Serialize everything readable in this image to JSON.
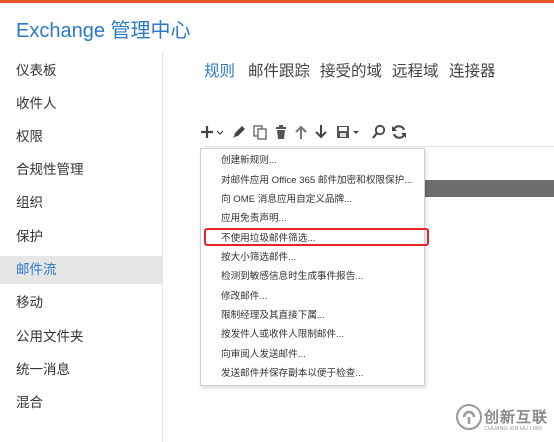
{
  "app": {
    "title": "Exchange 管理中心"
  },
  "sidebar": {
    "items": [
      {
        "label": "仪表板"
      },
      {
        "label": "收件人"
      },
      {
        "label": "权限"
      },
      {
        "label": "合规性管理"
      },
      {
        "label": "组织"
      },
      {
        "label": "保护"
      },
      {
        "label": "邮件流",
        "active": true
      },
      {
        "label": "移动"
      },
      {
        "label": "公用文件夹"
      },
      {
        "label": "统一消息"
      },
      {
        "label": "混合"
      }
    ]
  },
  "tabs": [
    {
      "label": "规则",
      "active": true
    },
    {
      "label": "邮件跟踪"
    },
    {
      "label": "接受的域"
    },
    {
      "label": "远程域"
    },
    {
      "label": "连接器"
    }
  ],
  "toolbar": {
    "buttons": [
      {
        "icon": "add-icon"
      },
      {
        "icon": "edit-icon"
      },
      {
        "icon": "copy-icon"
      },
      {
        "icon": "delete-icon"
      },
      {
        "icon": "arrow-up-icon"
      },
      {
        "icon": "arrow-down-icon"
      },
      {
        "icon": "save-icon"
      },
      {
        "icon": "search-icon"
      },
      {
        "icon": "refresh-icon"
      }
    ]
  },
  "menu": {
    "items": [
      {
        "label": "创建新规则..."
      },
      {
        "label": "对邮件应用 Office 365 邮件加密和权限保护..."
      },
      {
        "label": "向 OME 消息应用自定义品牌..."
      },
      {
        "label": "应用免责声明..."
      },
      {
        "label": "不使用垃圾邮件筛选...",
        "highlighted": true
      },
      {
        "label": "按大小筛选邮件..."
      },
      {
        "label": "检测到敏感信息时生成事件报告..."
      },
      {
        "label": "修改邮件..."
      },
      {
        "label": "限制经理及其直接下属..."
      },
      {
        "label": "按发件人或收件人限制邮件..."
      },
      {
        "label": "向审阅人发送邮件..."
      },
      {
        "label": "发送邮件并保存副本以便于检查..."
      }
    ]
  },
  "watermark": {
    "text": "创新互联",
    "sub": "CHUANG XIN HU LIAN"
  },
  "colors": {
    "accent": "#2a7ac6",
    "highlight_border": "#e8232a",
    "top_bar": "#e8532a",
    "active_bg": "#e6e6e6"
  }
}
